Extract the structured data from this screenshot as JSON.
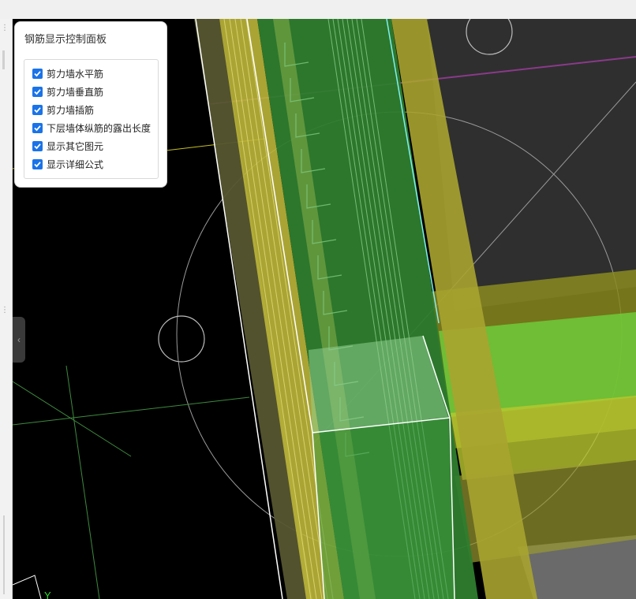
{
  "panel": {
    "title": "钢筋显示控制面板",
    "options": [
      {
        "label": "剪力墙水平筋",
        "checked": true
      },
      {
        "label": "剪力墙垂直筋",
        "checked": true
      },
      {
        "label": "剪力墙插筋",
        "checked": true
      },
      {
        "label": "下层墙体纵筋的露出长度",
        "checked": true
      },
      {
        "label": "显示其它图元",
        "checked": true
      },
      {
        "label": "显示详细公式",
        "checked": true
      }
    ]
  },
  "viewport": {
    "axis_label": "Y",
    "collapse_icon": "chevron-left-icon"
  },
  "colors": {
    "checkbox": "#1a73e8",
    "viewport_bg": "#000000",
    "wall_green": "#2e7d2e",
    "wall_yellow": "#bdb63a",
    "slab_gray": "#2e2e2e"
  }
}
